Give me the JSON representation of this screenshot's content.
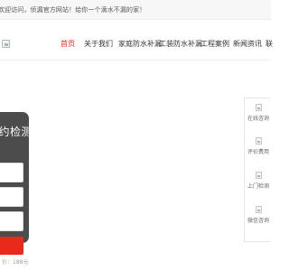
{
  "header": {
    "welcome_text": "欢迎访问，侦漏官方网站！给你一个滴水不漏的家！"
  },
  "nav": {
    "items": [
      {
        "label": "首页",
        "active": true
      },
      {
        "label": "关于我们",
        "active": false
      },
      {
        "label": "家庭防水补漏",
        "active": false
      },
      {
        "label": "工装防水补漏",
        "active": false
      },
      {
        "label": "工程案例",
        "active": false
      },
      {
        "label": "新闻资讯",
        "active": false
      },
      {
        "label": "联",
        "active": false
      }
    ]
  },
  "booking_form": {
    "title": "预约检测",
    "price_prefix": "价：",
    "price_value": "188元"
  },
  "sidebar": {
    "items": [
      {
        "label": "在线咨询",
        "icon": "chat-icon"
      },
      {
        "label": "评价费用",
        "icon": "price-icon"
      },
      {
        "label": "上门检测",
        "icon": "visit-icon"
      },
      {
        "label": "微信咨询",
        "icon": "wechat-icon"
      }
    ]
  },
  "colors": {
    "accent": "#e8291b",
    "form_bg": "#4c4c4c"
  }
}
